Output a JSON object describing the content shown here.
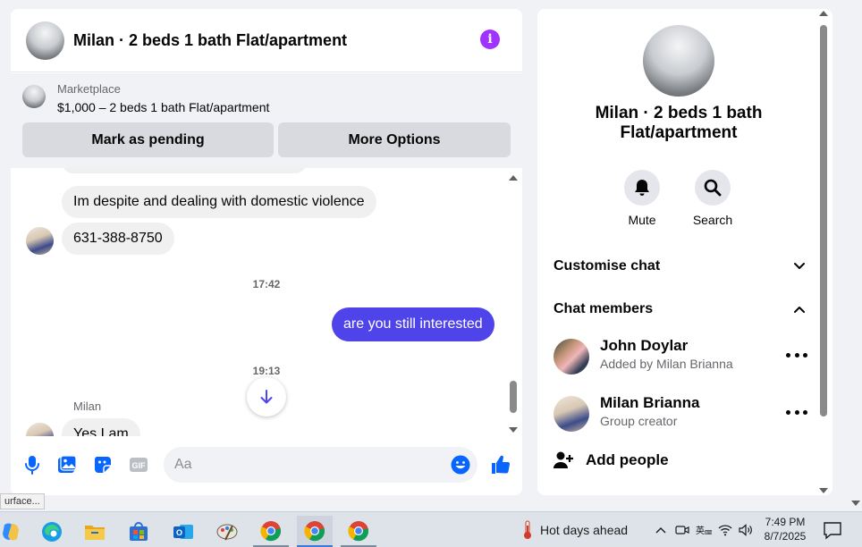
{
  "header": {
    "title": "Milan · 2 beds 1 bath Flat/apartment"
  },
  "marketplace": {
    "label": "Marketplace",
    "listing": "$1,000 – 2 beds 1 bath Flat/apartment",
    "pending_button": "Mark as pending",
    "more_button": "More Options"
  },
  "messages": {
    "items": [
      {
        "direction": "incoming",
        "text": "Im despite and dealing with domestic violence"
      },
      {
        "direction": "incoming",
        "text": "631-388-8750"
      },
      {
        "direction": "separator",
        "text": "17:42"
      },
      {
        "direction": "outgoing",
        "text": "are you still interested"
      },
      {
        "direction": "separator",
        "text": "19:13"
      },
      {
        "direction": "incoming",
        "sender": "Milan",
        "text": "Yes I am"
      }
    ]
  },
  "composer": {
    "placeholder": "Aa"
  },
  "details": {
    "title": "Milan · 2 beds 1 bath Flat/apartment",
    "actions": [
      {
        "icon": "bell-icon",
        "label": "Mute"
      },
      {
        "icon": "search-icon",
        "label": "Search"
      }
    ],
    "customise_label": "Customise chat",
    "members_label": "Chat members",
    "members": [
      {
        "name": "John Doylar",
        "subtitle": "Added by Milan Brianna"
      },
      {
        "name": "Milan Brianna",
        "subtitle": "Group creator"
      }
    ],
    "add_people_label": "Add people"
  },
  "status_tip": "urface...",
  "taskbar": {
    "weather": "Hot days ahead",
    "time": "7:49 PM",
    "date": "8/7/2025",
    "apps": [
      "copilot-icon",
      "edge-icon",
      "file-explorer-icon",
      "store-icon",
      "outlook-icon",
      "paint-icon",
      "chrome-icon",
      "chrome-icon",
      "chrome-icon"
    ]
  },
  "colors": {
    "accent": "#a033ff",
    "outgoing_bubble": "#4f43ea",
    "composer_icons": "#0866ff",
    "panel_bg": "#ffffff",
    "page_bg": "#f0f2f5"
  }
}
